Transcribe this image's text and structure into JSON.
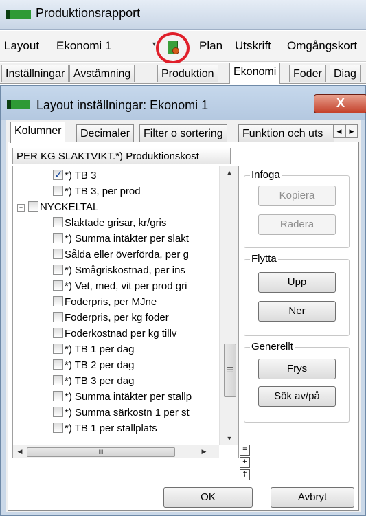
{
  "main_window": {
    "title": "Produktionsrapport",
    "menu": {
      "layout_label": "Layout",
      "layout_value": "Ekonomi 1",
      "items": [
        "Plan",
        "Utskrift",
        "Omgångskort"
      ]
    },
    "tabs": [
      "Inställningar",
      "Avstämning",
      "Produktion",
      "Ekonomi",
      "Foder",
      "Diag"
    ],
    "active_tab": "Ekonomi"
  },
  "dialog": {
    "title": "Layout inställningar: Ekonomi 1",
    "close_label": "X",
    "tabs": [
      "Kolumner",
      "Decimaler",
      "Filter o sortering",
      "Funktion och uts"
    ],
    "active_tab": "Kolumner",
    "column_header": "PER KG SLAKTVIKT.*) Produktionskost",
    "tree": [
      {
        "label": "*) TB 3",
        "checked": true
      },
      {
        "label": "*) TB 3, per prod",
        "checked": false
      },
      {
        "label": "NYCKELTAL",
        "checked": false,
        "group": true,
        "expander": "−"
      },
      {
        "label": "Slaktade grisar, kr/gris",
        "checked": false
      },
      {
        "label": "*) Summa intäkter per slakt",
        "checked": false
      },
      {
        "label": "Sålda eller överförda, per g",
        "checked": false
      },
      {
        "label": "*) Smågriskostnad, per ins",
        "checked": false
      },
      {
        "label": "*) Vet, med, vit per prod gri",
        "checked": false
      },
      {
        "label": "Foderpris, per MJne",
        "checked": false
      },
      {
        "label": "Foderpris, per kg foder",
        "checked": false
      },
      {
        "label": "Foderkostnad per kg tillv",
        "checked": false
      },
      {
        "label": "*) TB 1 per dag",
        "checked": false
      },
      {
        "label": "*) TB 2 per dag",
        "checked": false
      },
      {
        "label": "*) TB 3 per dag",
        "checked": false
      },
      {
        "label": "*) Summa intäkter per stallp",
        "checked": false
      },
      {
        "label": "*) Summa särkostn 1 per st",
        "checked": false
      },
      {
        "label": "*) TB 1 per stallplats",
        "checked": false
      }
    ],
    "tree_buttons": [
      "=",
      "+",
      "‡"
    ],
    "hscroll_grip": "III",
    "vscroll_grip": "☰",
    "groups": {
      "infoga": {
        "label": "Infoga",
        "buttons": [
          "Kopiera",
          "Radera"
        ]
      },
      "flytta": {
        "label": "Flytta",
        "buttons": [
          "Upp",
          "Ner"
        ]
      },
      "generellt": {
        "label": "Generellt",
        "buttons": [
          "Frys",
          "Sök av/på"
        ]
      }
    },
    "ok_label": "OK",
    "cancel_label": "Avbryt"
  }
}
